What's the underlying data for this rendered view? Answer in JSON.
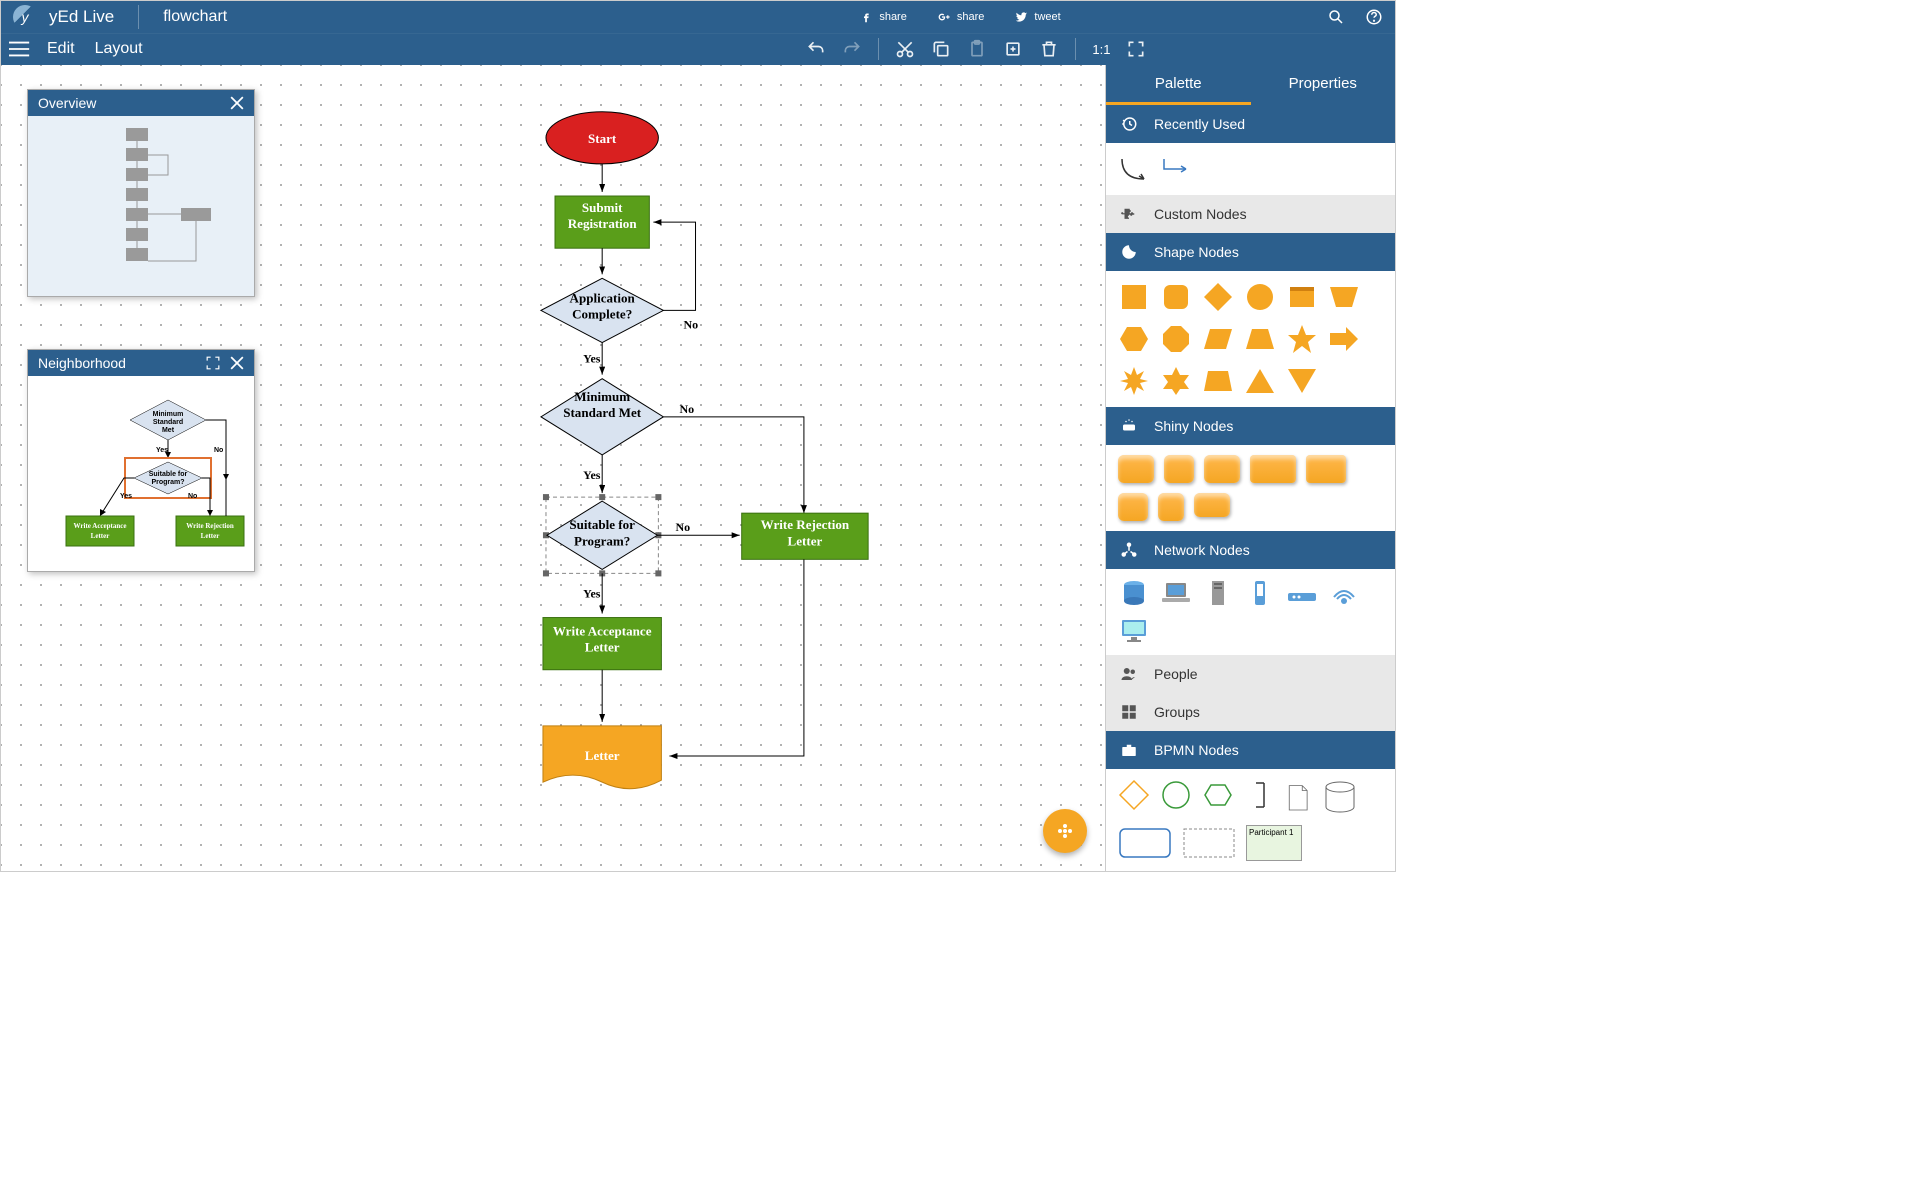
{
  "topbar": {
    "app_name": "yEd Live",
    "doc_name": "flowchart",
    "share_fb": "share",
    "share_gp": "share",
    "share_tw": "tweet"
  },
  "menu": {
    "edit": "Edit",
    "layout": "Layout",
    "fit": "1:1"
  },
  "overview": {
    "title": "Overview"
  },
  "neighborhood": {
    "title": "Neighborhood"
  },
  "sidebar": {
    "tab_palette": "Palette",
    "tab_properties": "Properties",
    "recently_used": "Recently Used",
    "custom_nodes": "Custom Nodes",
    "shape_nodes": "Shape Nodes",
    "shiny_nodes": "Shiny Nodes",
    "network_nodes": "Network Nodes",
    "people": "People",
    "groups": "Groups",
    "bpmn_nodes": "BPMN Nodes",
    "participant": "Participant 1"
  },
  "flow": {
    "start": "Start",
    "submit": "Submit Registration",
    "appcomplete": "Application Complete?",
    "minstd": "Minimum Standard Met",
    "suitable": "Suitable for Program?",
    "accept": "Write Acceptance Letter",
    "reject": "Write Rejection Letter",
    "letter": "Letter",
    "yes": "Yes",
    "no": "No"
  },
  "neigh": {
    "minstd": "Minimum Standard Met",
    "suitable": "Suitable for Program?",
    "accept": "Write Acceptance Letter",
    "reject": "Write Rejection Letter",
    "yes": "Yes",
    "no": "No"
  }
}
